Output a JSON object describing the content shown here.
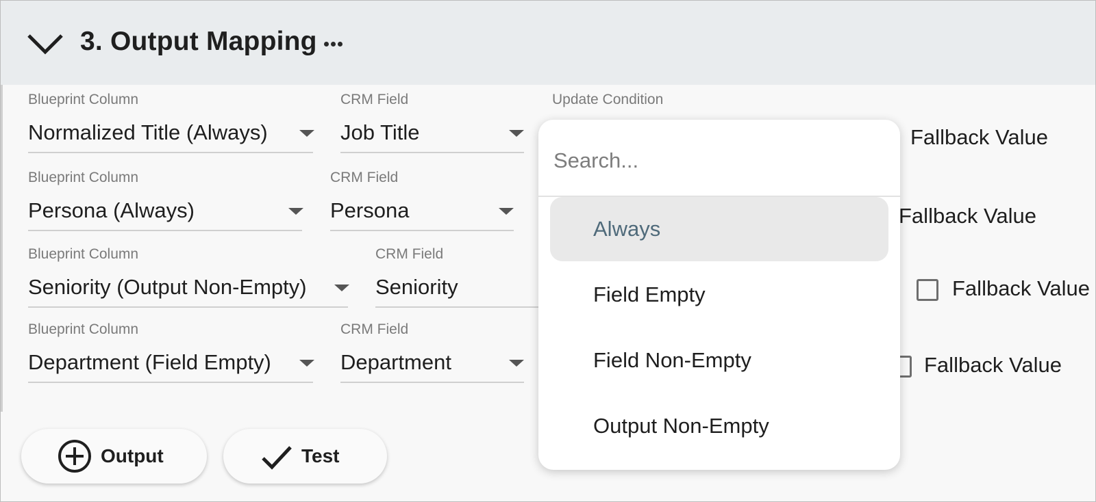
{
  "section": {
    "title": "3. Output Mapping"
  },
  "labels": {
    "blueprint_column": "Blueprint Column",
    "crm_field": "CRM Field",
    "update_condition": "Update Condition",
    "fallback_value": "Fallback Value"
  },
  "rows": [
    {
      "blueprint": "Normalized Title (Always)",
      "crm": "Job Title"
    },
    {
      "blueprint": "Persona (Always)",
      "crm": "Persona"
    },
    {
      "blueprint": "Seniority (Output Non-Empty)",
      "crm": "Seniority"
    },
    {
      "blueprint": "Department (Field Empty)",
      "crm": "Department"
    }
  ],
  "buttons": {
    "output": "Output",
    "test": "Test"
  },
  "dropdown": {
    "placeholder": "Search...",
    "options": [
      "Always",
      "Field Empty",
      "Field Non-Empty",
      "Output Non-Empty"
    ],
    "selected": "Always"
  }
}
